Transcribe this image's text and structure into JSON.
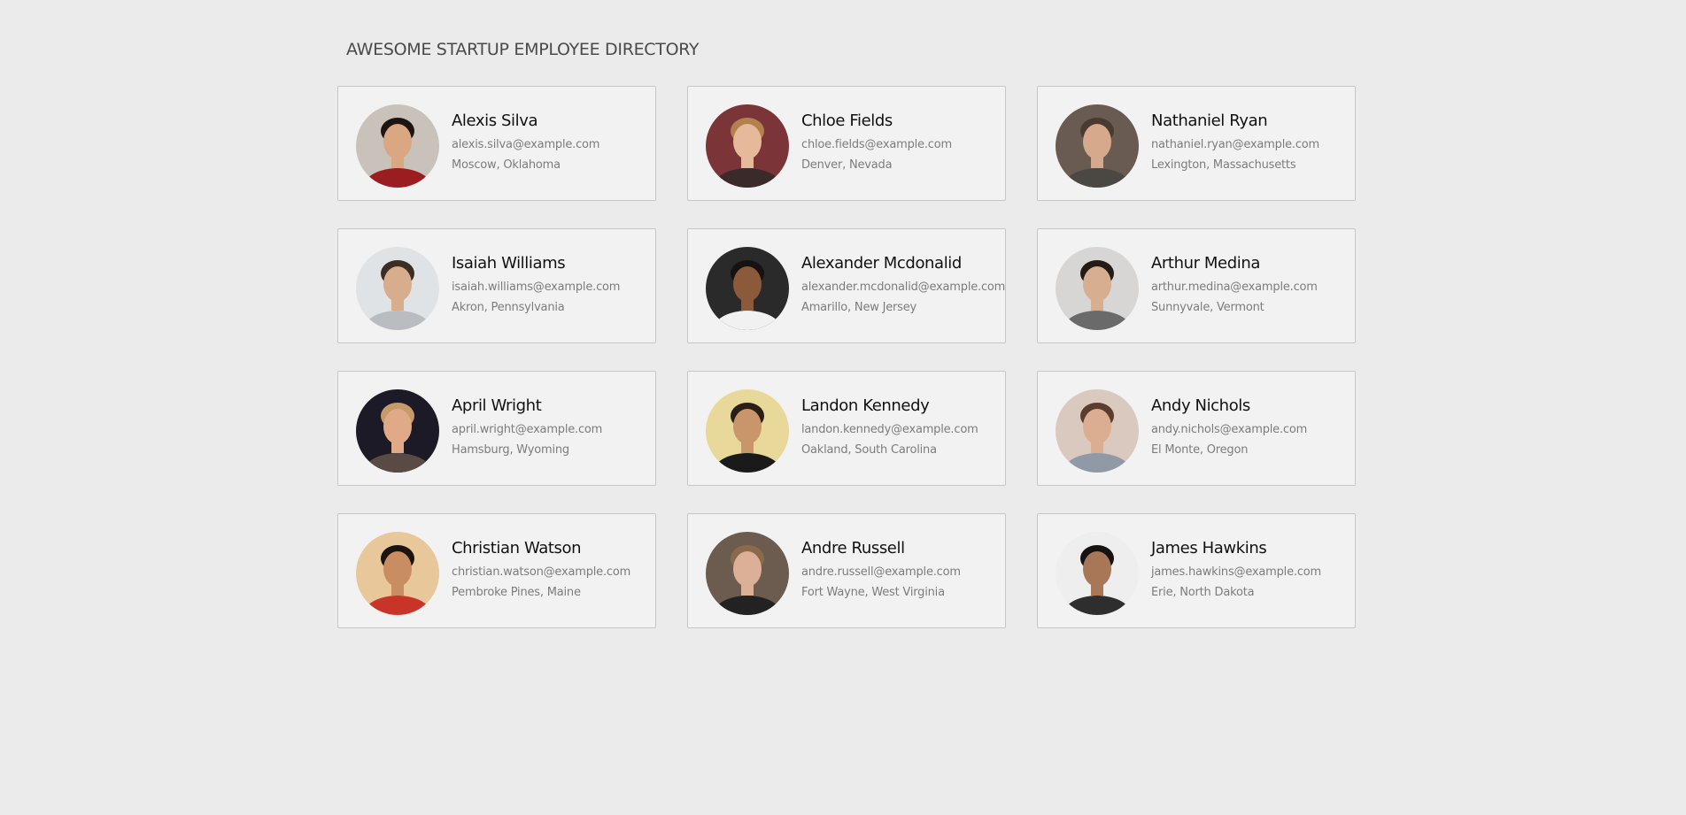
{
  "header": {
    "title": "AWESOME STARTUP EMPLOYEE DIRECTORY"
  },
  "employees": [
    {
      "name": "Alexis Silva",
      "email": "alexis.silva@example.com",
      "location": "Moscow, Oklahoma",
      "photo": {
        "bg": "#c8c2bb",
        "skin": "#d9a882",
        "hair": "#1e1512",
        "shirt": "#9b1d20"
      }
    },
    {
      "name": "Chloe Fields",
      "email": "chloe.fields@example.com",
      "location": "Denver, Nevada",
      "photo": {
        "bg": "#7b3438",
        "skin": "#e7b99b",
        "hair": "#b3814e",
        "shirt": "#3a2a2a"
      }
    },
    {
      "name": "Nathaniel Ryan",
      "email": "nathaniel.ryan@example.com",
      "location": "Lexington, Massachusetts",
      "photo": {
        "bg": "#6a5b52",
        "skin": "#d6a98c",
        "hair": "#4b3a2f",
        "shirt": "#4b4844"
      }
    },
    {
      "name": "Isaiah Williams",
      "email": "isaiah.williams@example.com",
      "location": "Akron, Pennsylvania",
      "photo": {
        "bg": "#dfe3e6",
        "skin": "#d8ad8e",
        "hair": "#3d2e24",
        "shirt": "#b9bcc0"
      }
    },
    {
      "name": "Alexander Mcdonalid",
      "email": "alexander.mcdonalid@example.com",
      "location": "Amarillo, New Jersey",
      "photo": {
        "bg": "#2a2a2a",
        "skin": "#8a5a3a",
        "hair": "#161212",
        "shirt": "#f1f1f1"
      }
    },
    {
      "name": "Arthur Medina",
      "email": "arthur.medina@example.com",
      "location": "Sunnyvale, Vermont",
      "photo": {
        "bg": "#d8d6d4",
        "skin": "#d7ae90",
        "hair": "#241b17",
        "shirt": "#6a6a6a"
      }
    },
    {
      "name": "April Wright",
      "email": "april.wright@example.com",
      "location": "Hamsburg, Wyoming",
      "photo": {
        "bg": "#1b1a26",
        "skin": "#e0aa88",
        "hair": "#c79a6a",
        "shirt": "#5a4a44"
      }
    },
    {
      "name": "Landon Kennedy",
      "email": "landon.kennedy@example.com",
      "location": "Oakland, South Carolina",
      "photo": {
        "bg": "#e8d89a",
        "skin": "#c9966c",
        "hair": "#2b1e16",
        "shirt": "#1a1a1a"
      }
    },
    {
      "name": "Andy Nichols",
      "email": "andy.nichols@example.com",
      "location": "El Monte, Oregon",
      "photo": {
        "bg": "#d9c9bf",
        "skin": "#dcae91",
        "hair": "#5a3d2e",
        "shirt": "#8f9aa6"
      }
    },
    {
      "name": "Christian Watson",
      "email": "christian.watson@example.com",
      "location": "Pembroke Pines, Maine",
      "photo": {
        "bg": "#e8c79a",
        "skin": "#c98d62",
        "hair": "#1c1410",
        "shirt": "#c83528"
      }
    },
    {
      "name": "Andre Russell",
      "email": "andre.russell@example.com",
      "location": "Fort Wayne, West Virginia",
      "photo": {
        "bg": "#6b5c4f",
        "skin": "#dcb096",
        "hair": "#8b6a4c",
        "shirt": "#222222"
      }
    },
    {
      "name": "James Hawkins",
      "email": "james.hawkins@example.com",
      "location": "Erie, North Dakota",
      "photo": {
        "bg": "#eeeeee",
        "skin": "#a87758",
        "hair": "#171312",
        "shirt": "#2e2e2e"
      }
    }
  ]
}
